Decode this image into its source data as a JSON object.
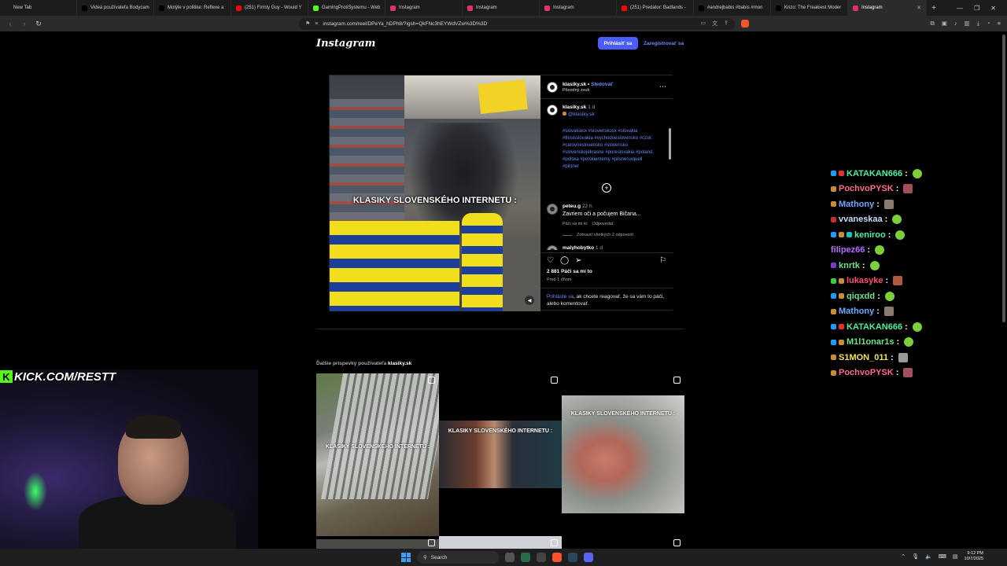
{
  "browser": {
    "tabs": [
      {
        "label": "New Tab",
        "color": "#1c1c1c"
      },
      {
        "label": "Videá používateľa Bodycam",
        "color": "#000000"
      },
      {
        "label": "Motýle v politike: Reflexe a",
        "color": "#000000"
      },
      {
        "label": "(251) Firmly Guy - Would Y",
        "color": "#ff0000"
      },
      {
        "label": "GamingProtiSystemu - Web",
        "color": "#53fc18"
      },
      {
        "label": "Instagram",
        "color": "#e1306c"
      },
      {
        "label": "Instagram",
        "color": "#e1306c"
      },
      {
        "label": "Instagram",
        "color": "#e1306c"
      },
      {
        "label": "(251) Predator: Badlands -",
        "color": "#ff0000"
      },
      {
        "label": "#andrejbabis #babis #mon",
        "color": "#000000"
      },
      {
        "label": "Krizo: The Freakiest Moder",
        "color": "#000000"
      }
    ],
    "active_tab": {
      "label": "Instagram",
      "color": "#e1306c"
    },
    "url": "instagram.com/reel/DPeYa_hDPh8/?igsh=QkFNc3hEYWdVZw%3D%3D"
  },
  "instagram": {
    "logo": "Instagram",
    "login_button": "Prihlásiť sa",
    "signup_link": "Zaregistrovať sa",
    "post": {
      "video_caption": "KLASIKY SLOVENSKÉHO INTERNETU :",
      "username": "klasiky.sk",
      "separator": " • ",
      "follow": "Sledovať",
      "audio": "Pôvodný zvuk",
      "caption_user": "klasiky.sk",
      "caption_time": "1 d",
      "caption_handle": "@klasiky.sk",
      "hashtags": "#slovakiasx #slovenskosx #slovakia #thisisslovakia #vychodneslovensko #czsk #carovneslovensko #slovensko #slovenskojekrasne #pureslovakia #poland #polska #polskiememy #pilsnerurquell #pilsner",
      "comments": [
        {
          "user": "peteu.g",
          "time": "22 h",
          "text": "Zavriem oči a počujem Bičana...",
          "like": "Páči sa mi to",
          "reply": "Odpovedať",
          "view_replies": "Zobraziť všetkých 2 odpovedí"
        },
        {
          "user": "malyhobytko",
          "time": "1 d"
        }
      ],
      "likes": "2 881 Páči sa mi to",
      "posted": "Pred 1 dňom",
      "login_link": "Prihláste sa",
      "login_rest": ", ak chcete reagovať, že sa vám to páči, alebo komentovať."
    },
    "more_posts_prefix": "Ďalšie príspevky používateľa ",
    "more_posts_user": "klasiky.sk",
    "thumbs": [
      {
        "caption": "KLASIKY SLOVENSKÉHO INTERNETU :"
      },
      {
        "caption": "KLASIKY SLOVENSKÉHO INTERNETU :"
      },
      {
        "caption": "KLASIKY SLOVENSKÉHO INTERNETU :"
      }
    ]
  },
  "chat": [
    {
      "name": "KATAKAN666",
      "color": "#4ef0a0",
      "badges": [
        "#1e9bff",
        "#e03030"
      ],
      "emote": "#7ccf3a"
    },
    {
      "name": "PochvoPYSK",
      "color": "#ff6b8a",
      "badges": [
        "#c98a3a"
      ],
      "emote": "#a0505a"
    },
    {
      "name": "Mathony",
      "color": "#6fa8ff",
      "badges": [
        "#c98a3a"
      ],
      "emote": "#8a7a70"
    },
    {
      "name": "vvaneskaa",
      "color": "#c8d8ff",
      "badges": [
        "#c03030"
      ],
      "emote": "#7ccf3a"
    },
    {
      "name": "keniroo",
      "color": "#4ef0a0",
      "badges": [
        "#1e9bff",
        "#c98a3a",
        "#20c0c0"
      ],
      "emote": "#7ccf3a"
    },
    {
      "name": "filipez66",
      "color": "#b46bff",
      "badges": [],
      "emote": "#7ccf3a"
    },
    {
      "name": "knrtk",
      "color": "#6fe08a",
      "badges": [
        "#7a3ad0"
      ],
      "emote": "#7ccf3a"
    },
    {
      "name": "lukasyke",
      "color": "#ff4d6d",
      "badges": [
        "#3acf3a",
        "#c98a3a"
      ],
      "emote": "#b05a40"
    },
    {
      "name": "qiqxdd",
      "color": "#6fe08a",
      "badges": [
        "#1e9bff",
        "#c98a3a"
      ],
      "emote": "#7ccf3a"
    },
    {
      "name": "Mathony",
      "color": "#6fa8ff",
      "badges": [
        "#c98a3a"
      ],
      "emote": "#8a7a70"
    },
    {
      "name": "KATAKAN666",
      "color": "#4ef0a0",
      "badges": [
        "#1e9bff",
        "#e03030"
      ],
      "emote": "#7ccf3a"
    },
    {
      "name": "M1l1onar1s",
      "color": "#6fe08a",
      "badges": [
        "#1e9bff",
        "#c98a3a"
      ],
      "emote": "#7ccf3a"
    },
    {
      "name": "S1MON_011",
      "color": "#f0e060",
      "badges": [
        "#c98a3a"
      ],
      "emote": "#9a9a9a"
    },
    {
      "name": "PochvoPYSK",
      "color": "#ff6b8a",
      "badges": [
        "#c98a3a"
      ],
      "emote": "#a0505a"
    }
  ],
  "stream": {
    "kick_banner": "KICK.COM/RESTT",
    "kick_letter": "K"
  },
  "taskbar": {
    "search": "Search",
    "time": "9:12 PM",
    "date": "10/7/2025"
  }
}
